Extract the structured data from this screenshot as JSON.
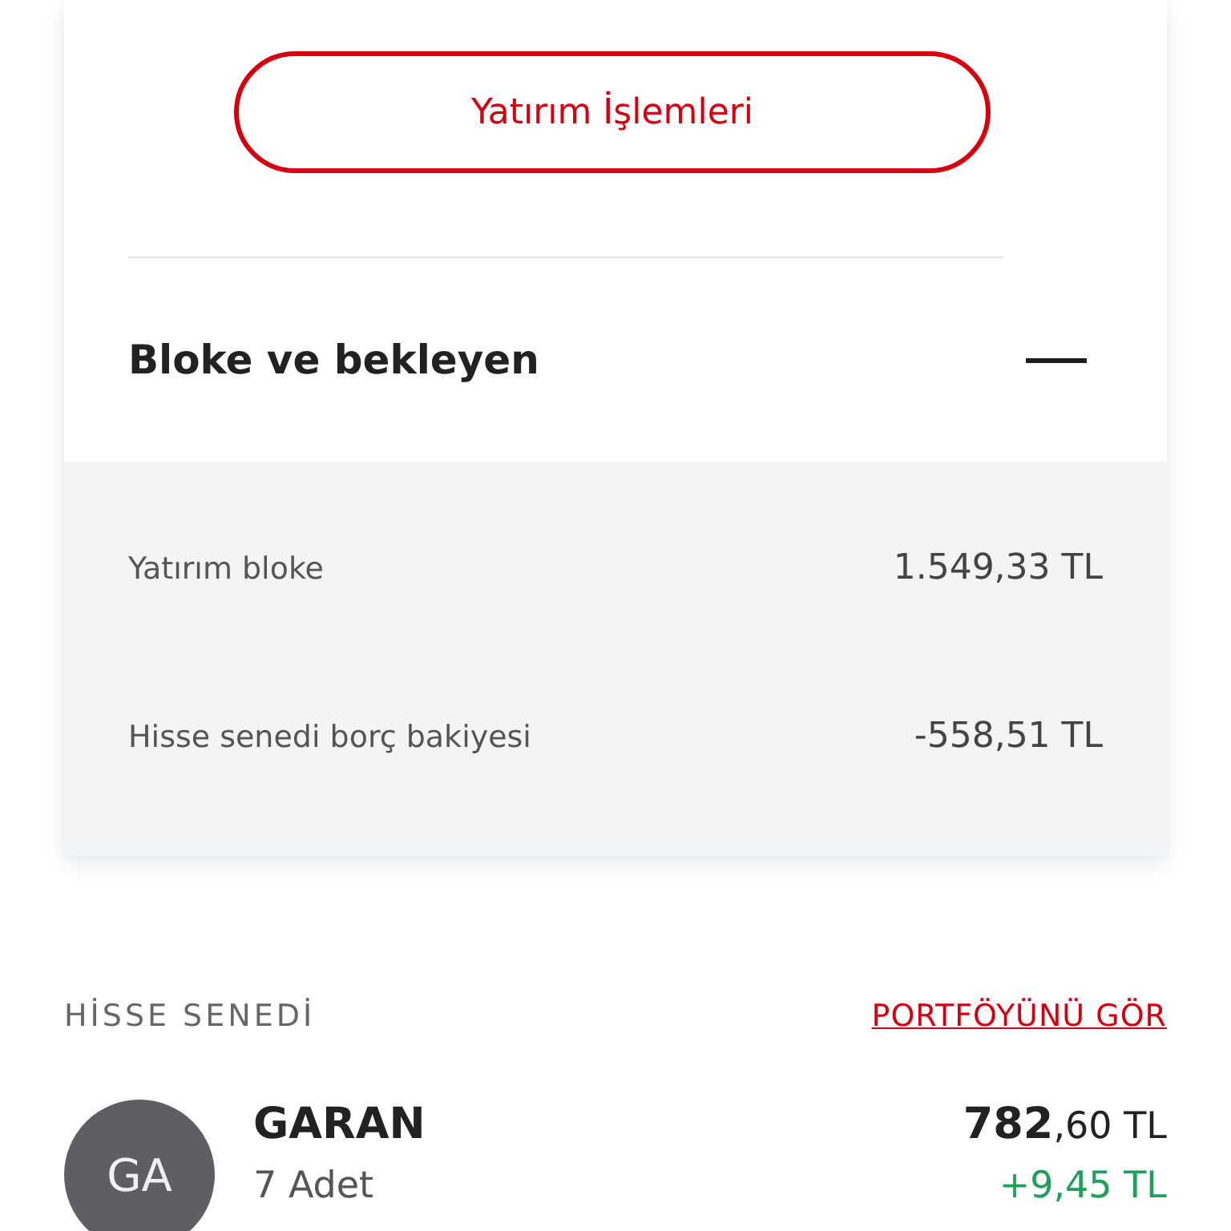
{
  "card": {
    "action_button": "Yatırım İşlemleri",
    "section": {
      "title": "Bloke ve bekleyen",
      "expanded": true,
      "rows": [
        {
          "label": "Yatırım bloke",
          "value": "1.549,33 TL"
        },
        {
          "label": "Hisse senedi borç bakiyesi",
          "value": "-558,51 TL"
        }
      ]
    }
  },
  "stocks": {
    "heading": "HİSSE SENEDİ",
    "link": "PORTFÖYÜNÜ GÖR",
    "items": [
      {
        "initials": "GA",
        "symbol": "GARAN",
        "quantity": "7 Adet",
        "price_main": "782",
        "price_fraction": ",60 TL",
        "change": "+9,45 TL"
      }
    ]
  }
}
